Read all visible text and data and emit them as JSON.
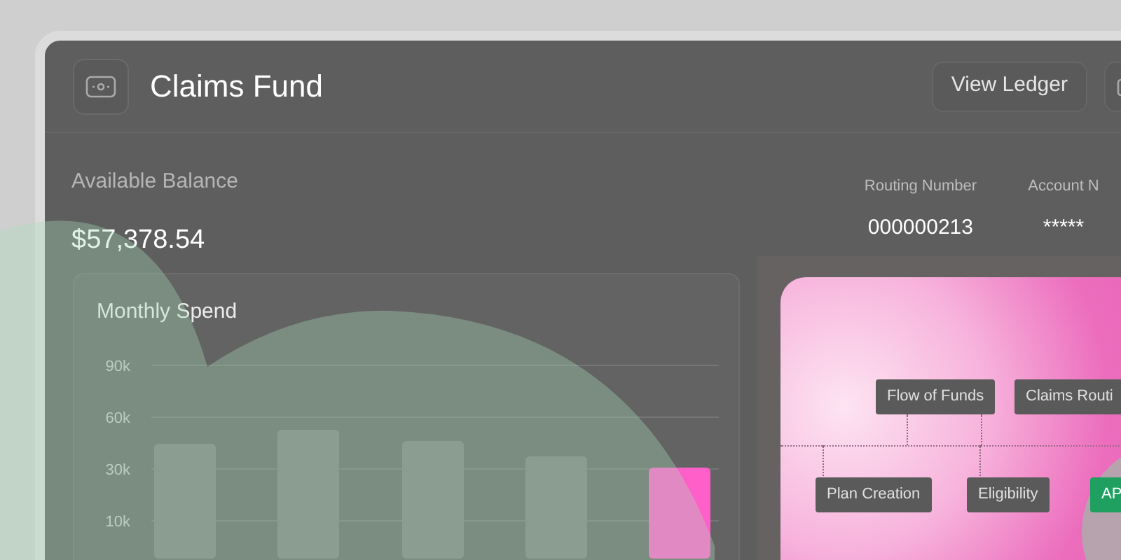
{
  "header": {
    "title": "Claims Fund",
    "buttons": [
      "View Ledger"
    ]
  },
  "balance": {
    "label": "Available Balance",
    "amount": "$57,378.54"
  },
  "account_details": [
    {
      "label": "Routing Number",
      "value": "000000213"
    },
    {
      "label": "Account N",
      "value": "*****"
    }
  ],
  "monthly_spend": {
    "title": "Monthly Spend",
    "y_axis_labels": [
      "90k",
      "60k",
      "30k",
      "10k"
    ]
  },
  "flow_diagram": {
    "top_nodes": [
      {
        "label": "Flow of Funds",
        "highlighted": false
      },
      {
        "label": "Claims Routi",
        "highlighted": false
      }
    ],
    "bottom_nodes": [
      {
        "label": "Plan Creation",
        "highlighted": false
      },
      {
        "label": "Eligibility",
        "highlighted": false
      },
      {
        "label": "AP",
        "highlighted": true
      }
    ]
  }
}
